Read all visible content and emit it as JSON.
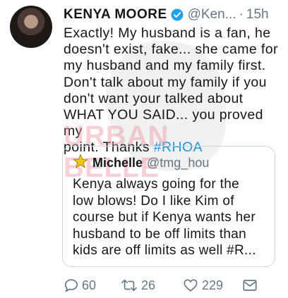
{
  "tweet": {
    "author_name": "KENYA MOORE",
    "handle": "@Ken...",
    "separator": "·",
    "time": "15h",
    "text_lines": [
      "Exactly! My husband is a fan, he",
      "doesn't exist, fake... she came for",
      "my husband and my family first.",
      "Don't talk about my family if you",
      "don't want your talked about",
      "WHAT YOU SAID... you proved my",
      "point. Thanks "
    ],
    "hashtag": "#RHOA"
  },
  "watermark": "URBAN BELLE",
  "quoted_tweet": {
    "name": "Michelle",
    "handle": "@tmg_hou",
    "text_lines": [
      "Kenya always going for the",
      "low blows! Do I like Kim of",
      "course but if Kenya wants her",
      "husband to be off limits than",
      "kids are off limits as well #R..."
    ]
  },
  "actions": {
    "replies": "60",
    "retweets": "26",
    "likes": "229"
  },
  "colors": {
    "link": "#1b95e0",
    "secondary": "#657786",
    "verified": "#1da1f2",
    "star": "#f5c518"
  }
}
